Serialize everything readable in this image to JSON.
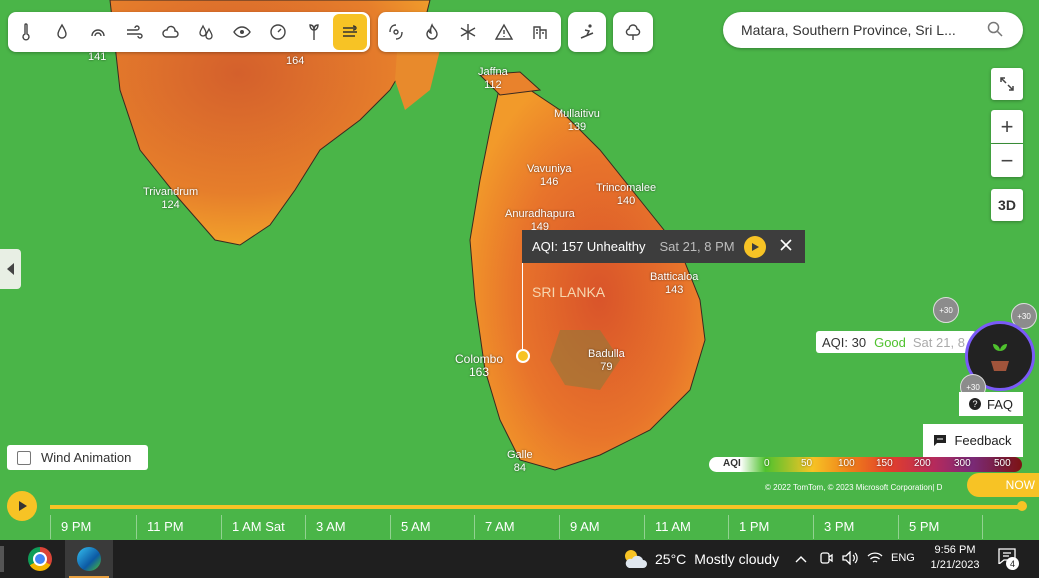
{
  "toolbar_primary": [
    "thermometer-icon",
    "droplet-icon",
    "rain-gauge-icon",
    "wind-icon",
    "cloud-icon",
    "humidity-icon",
    "visibility-icon",
    "pressure-icon",
    "pollen-icon",
    "air-quality-icon"
  ],
  "toolbar_secondary": [
    "hurricane-icon",
    "fire-icon",
    "snowflake-icon",
    "warning-icon",
    "buildings-icon"
  ],
  "search": {
    "value": "Matara, Southern Province, Sri L..."
  },
  "controls": {
    "fullscreen": "fullscreen-icon",
    "zoom_in": "+",
    "zoom_out": "−",
    "three_d": "3D"
  },
  "map_labels": [
    {
      "name": "",
      "value": "141"
    },
    {
      "name": "",
      "value": "164"
    },
    {
      "name": "Jaffna",
      "value": "112"
    },
    {
      "name": "Mullaitivu",
      "value": "139"
    },
    {
      "name": "Vavuniya",
      "value": "146"
    },
    {
      "name": "Trincomalee",
      "value": "140"
    },
    {
      "name": "Trivandrum",
      "value": "124"
    },
    {
      "name": "Anuradhapura",
      "value": "149"
    },
    {
      "name": "Batticaloa",
      "value": "143"
    },
    {
      "name": "Colombo",
      "value": "163"
    },
    {
      "name": "Badulla",
      "value": "79"
    },
    {
      "name": "Galle",
      "value": "84"
    }
  ],
  "country_label": "SRI LANKA",
  "tooltip": {
    "value": "AQI: 157 Unhealthy",
    "time": "Sat 21, 8 PM"
  },
  "secondary_tooltip": {
    "value": "AQI: 30",
    "status": "Good",
    "time": "Sat 21, 8"
  },
  "badges": [
    "+30",
    "+30",
    "+30"
  ],
  "faq_label": "FAQ",
  "feedback_label": "Feedback",
  "wind_animation_label": "Wind Animation",
  "legend": {
    "title": "AQI",
    "ticks": [
      "0",
      "50",
      "100",
      "150",
      "200",
      "300",
      "500"
    ]
  },
  "attribution": "© 2022 TomTom, © 2023 Microsoft Corporation| D",
  "now_label": "NOW",
  "timeline": [
    "9 PM",
    "11 PM",
    "1 AM Sat",
    "3 AM",
    "5 AM",
    "7 AM",
    "9 AM",
    "11 AM",
    "1 PM",
    "3 PM",
    "5 PM"
  ],
  "taskbar": {
    "weather_temp": "25°C",
    "weather_text": "Mostly cloudy",
    "lang": "ENG",
    "time": "9:56 PM",
    "date": "1/21/2023",
    "notif_count": "4"
  },
  "colors": {
    "accent": "#f7c325",
    "good": "#4fc22e"
  }
}
